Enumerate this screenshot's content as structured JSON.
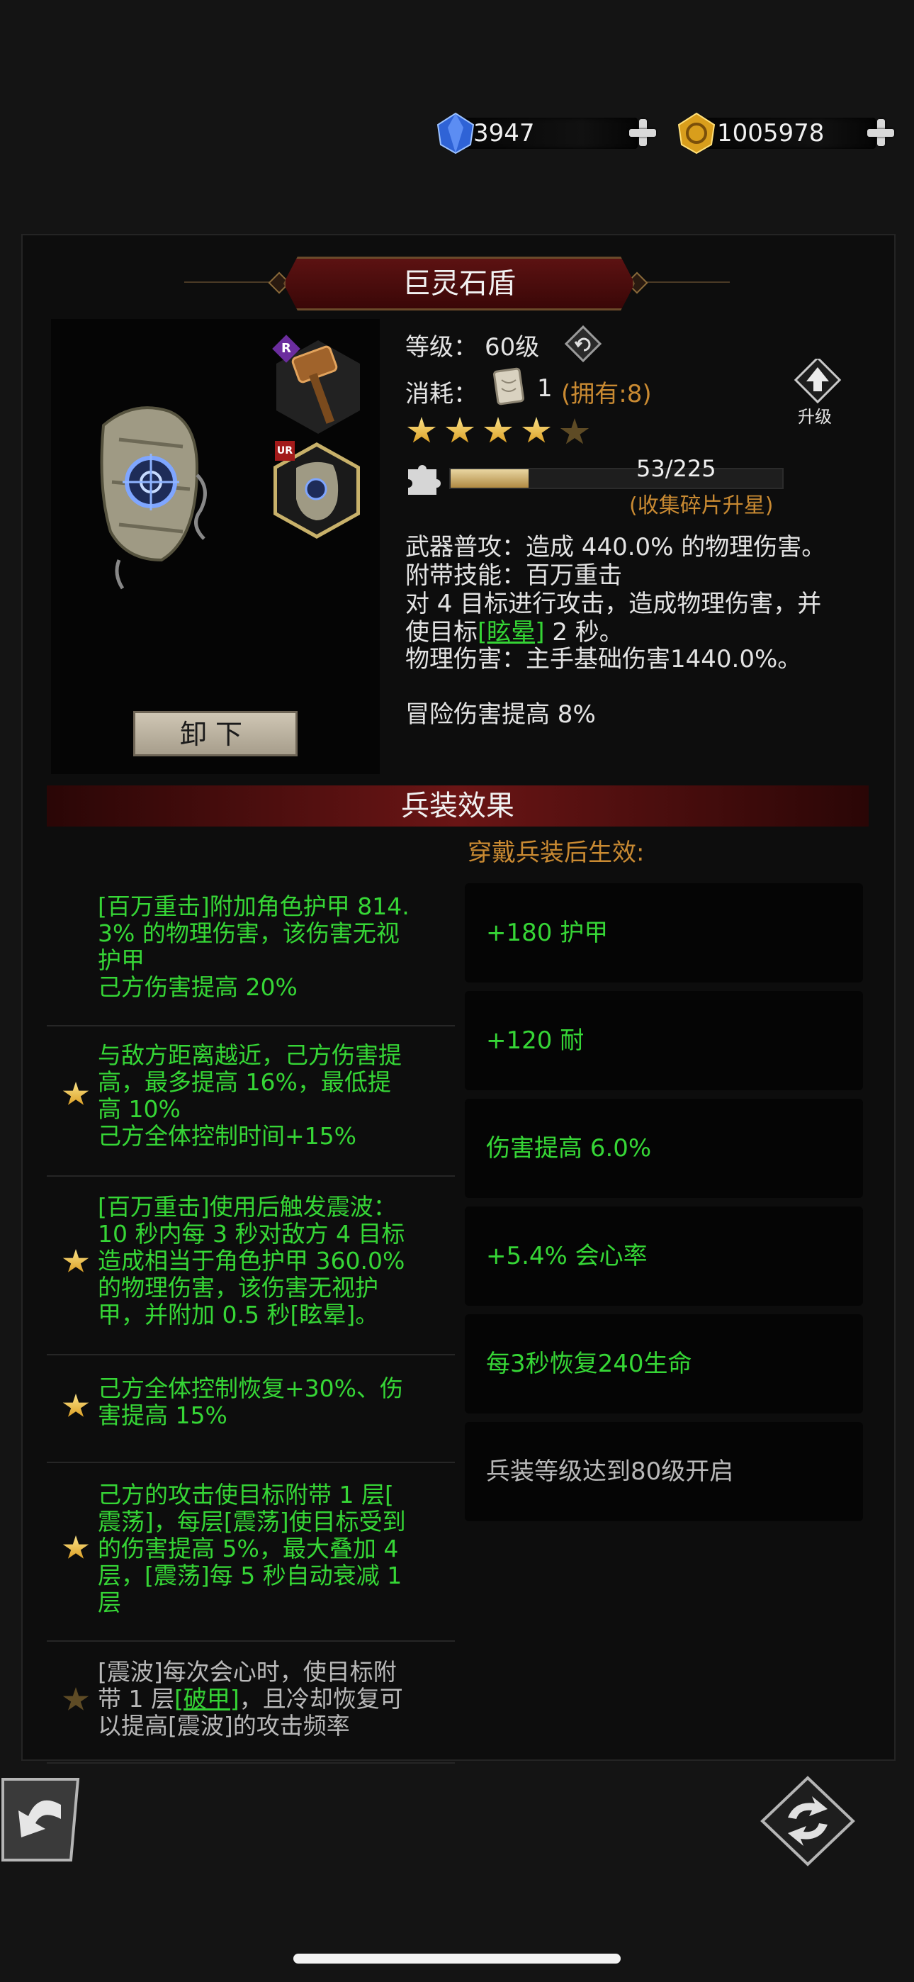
{
  "currency": {
    "gems": "3947",
    "gold": "1005978"
  },
  "item": {
    "name": "巨灵石盾",
    "slot_badge_weapon": "R",
    "slot_badge_shield": "UR",
    "unequip_label": "卸下"
  },
  "info": {
    "level_label": "等级：",
    "level_value": "60级",
    "cost_label": "消耗：",
    "cost_count": "1",
    "owned": "(拥有:8)",
    "upgrade_label": "升级",
    "stars_total": 5,
    "stars_lit": 4,
    "fragments": "53/225",
    "fragment_progress": 0.2356,
    "fragment_hint": "(收集碎片升星)",
    "desc_line1": "武器普攻：造成 440.0% 的物理伤害。",
    "desc_line2": "附带技能：百万重击",
    "desc_line3": "对 4 目标进行攻击，造成物理伤害，并",
    "desc_line4_pre": "使目标",
    "desc_line4_link": "[眩晕]",
    "desc_line4_post": " 2 秒。",
    "desc_line5": "物理伤害：主手基础伤害1440.0%。",
    "bonus": "冒险伤害提高 8%"
  },
  "effects": {
    "header": "兵装效果",
    "sub": "穿戴兵装后生效:",
    "items": [
      {
        "lines": [
          "[百万重击]附加角色护甲 814.",
          "3% 的物理伤害，该伤害无视",
          "护甲",
          "己方伤害提高 20%"
        ]
      },
      {
        "lines": [
          "与敌方距离越近，己方伤害提",
          "高，最多提高 16%，最低提",
          "高 10%",
          "己方全体控制时间+15%"
        ]
      },
      {
        "lines": [
          "[百万重击]使用后触发震波：",
          "10 秒内每 3 秒对敌方 4 目标",
          "造成相当于角色护甲 360.0%",
          "的物理伤害，该伤害无视护",
          "甲，并附加 0.5 秒[眩晕]。"
        ]
      },
      {
        "lines": [
          "己方全体控制恢复+30%、伤",
          "害提高 15%"
        ]
      },
      {
        "lines": [
          "己方的攻击使目标附带 1 层[",
          "震荡]，每层[震荡]使目标受到",
          "的伤害提高 5%，最大叠加 4",
          "层，[震荡]每 5 秒自动衰减 1",
          "层"
        ]
      },
      {
        "line1": "[震波]每次会心时，使目标附",
        "line2_pre": "带 1 层",
        "line2_link": "[破甲]",
        "line2_post": "，且冷却恢复可",
        "line3": "以提高[震波]的攻击频率"
      }
    ],
    "stats": [
      "+180 护甲",
      "+120 耐",
      "伤害提高 6.0%",
      "+5.4% 会心率",
      "每3秒恢复240生命",
      "兵装等级达到80级开启"
    ]
  },
  "colors": {
    "green": "#36d636",
    "orange": "#c98a32",
    "panel": "#0d0d0d",
    "title_red": "#5c1212"
  }
}
